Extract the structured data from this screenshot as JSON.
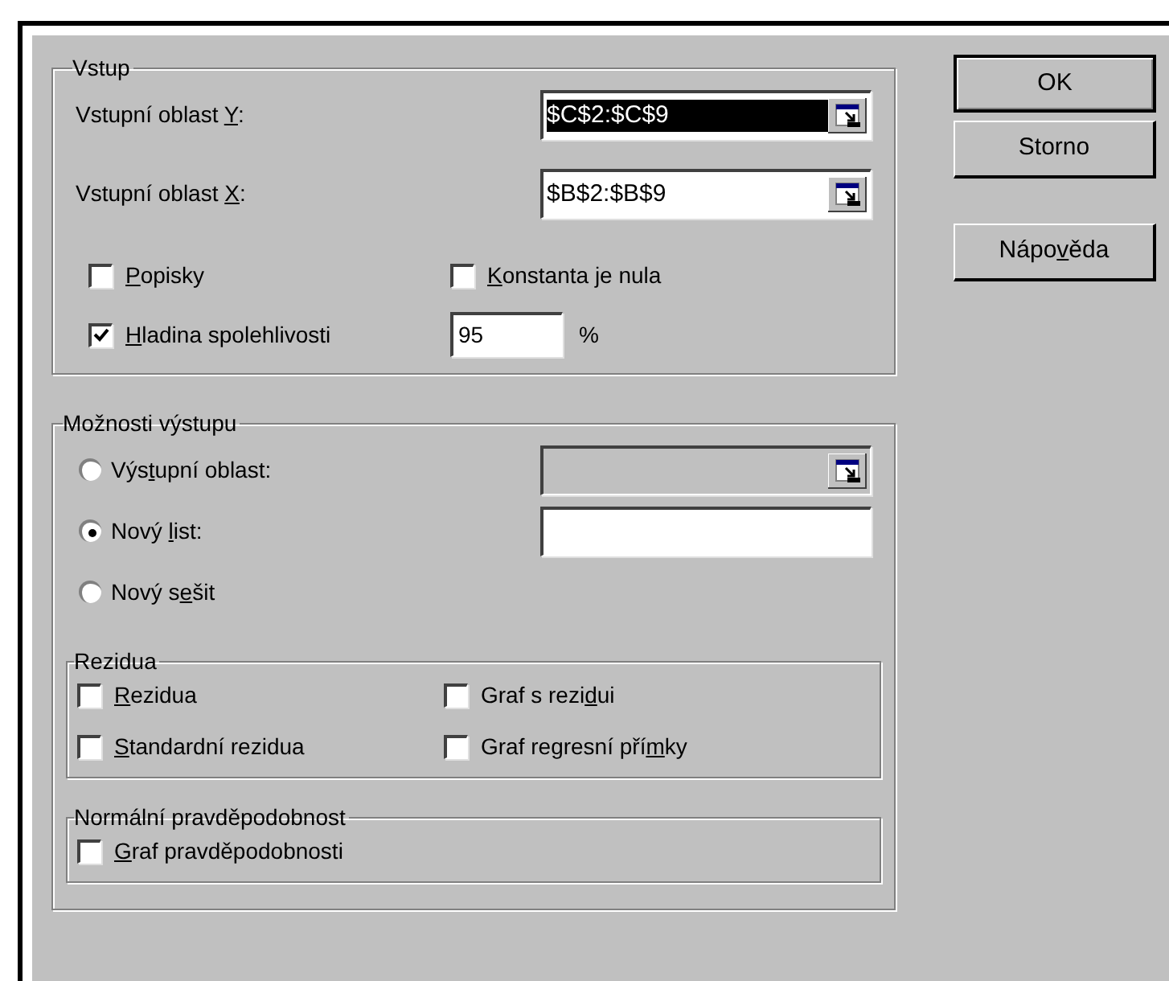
{
  "input_group": {
    "title": "Vstup",
    "fields": [
      {
        "label": {
          "pre": "Vstupní oblast ",
          "key": "Y",
          "post": ":"
        },
        "value": "$C$2:$C$9",
        "text_selected": true
      },
      {
        "label": {
          "pre": "Vstupní oblast ",
          "key": "X",
          "post": ":"
        },
        "value": "$B$2:$B$9",
        "text_selected": false
      }
    ],
    "checkboxes": [
      {
        "label": {
          "key": "P",
          "post": "opisky"
        },
        "checked": false
      },
      {
        "label": {
          "key": "K",
          "post": "onstanta je nula"
        },
        "checked": false
      },
      {
        "label": {
          "key": "H",
          "post": "ladina spolehlivosti"
        },
        "checked": true
      }
    ],
    "confidence_value": "95",
    "confidence_unit": "%"
  },
  "output_group": {
    "title": "Možnosti výstupu",
    "options": [
      {
        "label": {
          "pre": "Výs",
          "key": "t",
          "post": "upní oblast:"
        },
        "selected": false,
        "field": {
          "disabled": true,
          "range_button": true
        }
      },
      {
        "label": {
          "pre": "Nový ",
          "key": "l",
          "post": "ist:"
        },
        "selected": true,
        "field": {
          "disabled": false,
          "range_button": false
        }
      },
      {
        "label": {
          "pre": "Nový s",
          "key": "e",
          "post": "šit"
        },
        "selected": false
      }
    ],
    "residuals": {
      "title": "Rezidua",
      "checkboxes": [
        {
          "label": {
            "key": "R",
            "post": "ezidua"
          },
          "checked": false
        },
        {
          "label": {
            "pre": "Graf s rezi",
            "key": "d",
            "post": "ui"
          },
          "checked": false
        },
        {
          "label": {
            "key": "S",
            "post": "tandardní rezidua"
          },
          "checked": false
        },
        {
          "label": {
            "pre": "Graf regresní pří",
            "key": "m",
            "post": "ky"
          },
          "checked": false
        }
      ]
    },
    "normal_probability": {
      "title": "Normální pravděpodobnost",
      "checkboxes": [
        {
          "label": {
            "key": "G",
            "post": "raf pravděpodobnosti"
          },
          "checked": false
        }
      ]
    }
  },
  "buttons": [
    {
      "label": {
        "pre": "OK"
      },
      "default": true
    },
    {
      "label": {
        "pre": "Storno"
      },
      "default": false
    },
    {
      "label": {
        "pre": "Nápo",
        "key": "v",
        "post": "ěda"
      },
      "default": false
    }
  ]
}
